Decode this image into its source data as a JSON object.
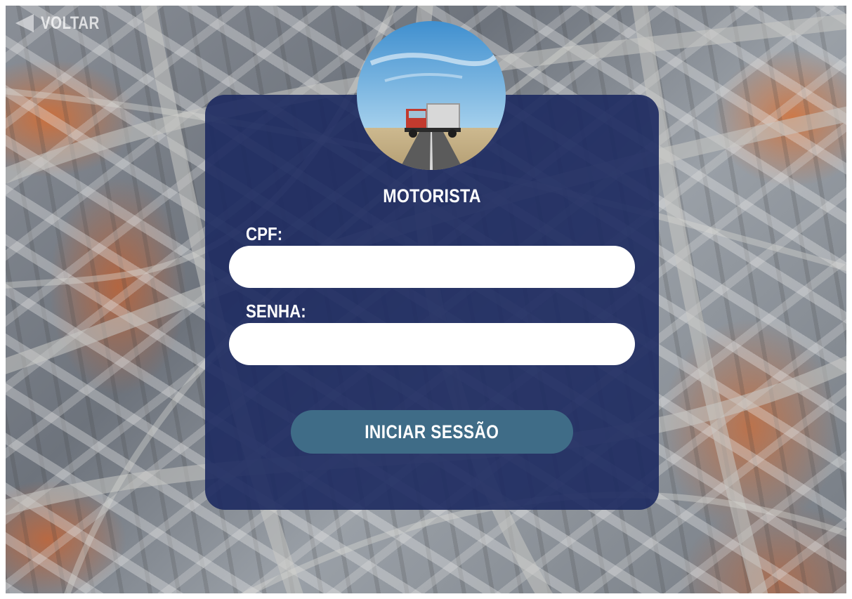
{
  "back": {
    "label": "VOLTAR",
    "icon": "back-arrow-icon"
  },
  "login": {
    "role_title": "MOTORISTA",
    "avatar_icon": "truck-photo",
    "cpf_label": "CPF:",
    "cpf_value": "",
    "password_label": "SENHA:",
    "password_value": "",
    "submit_label": "INICIAR SESSÃO"
  },
  "colors": {
    "card": "#1d2a60",
    "button": "#3f6c87",
    "input": "#ffffff",
    "text": "#ffffff"
  }
}
